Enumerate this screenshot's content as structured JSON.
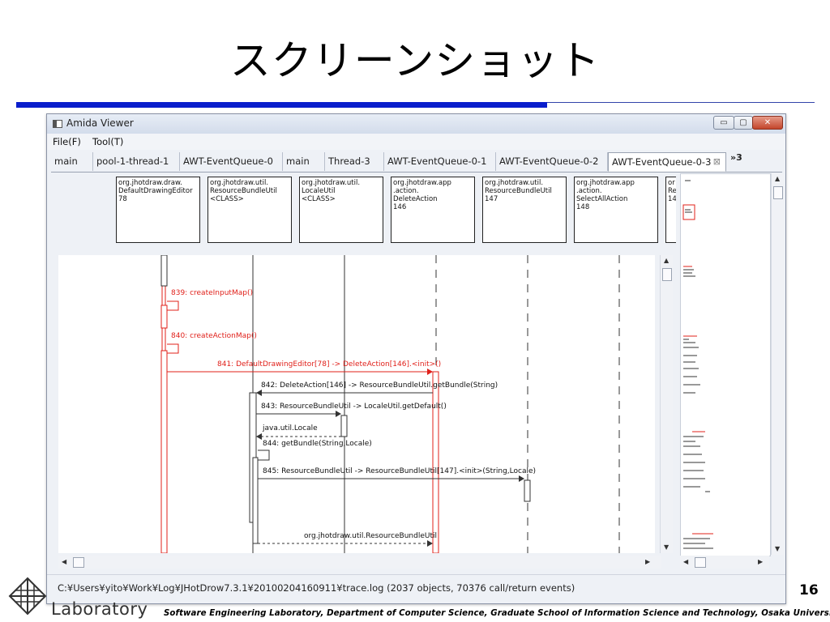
{
  "slide": {
    "title": "スクリーンショット",
    "page_number": "16",
    "logo_text": "Laboratory",
    "footer": "Software Engineering Laboratory, Department of Computer Science, Graduate School of Information Science and Technology, Osaka University"
  },
  "window": {
    "title": "Amida Viewer",
    "buttons": {
      "minimize": "▭",
      "maximize": "▢",
      "close": "✕"
    }
  },
  "menu": {
    "file": "File(F)",
    "tool": "Tool(T)"
  },
  "tabs": [
    {
      "label": "main"
    },
    {
      "label": "pool-1-thread-1"
    },
    {
      "label": "AWT-EventQueue-0"
    },
    {
      "label": "main"
    },
    {
      "label": "Thread-3"
    },
    {
      "label": "AWT-EventQueue-0-1"
    },
    {
      "label": "AWT-EventQueue-0-2"
    },
    {
      "label": "AWT-EventQueue-0-3",
      "active": true
    }
  ],
  "tab_more": "»3",
  "tab_close_glyph": "⊠",
  "lanes": [
    "org.jhotdraw.draw.\nDefaultDrawingEditor\n78",
    "org.jhotdraw.util.\nResourceBundleUtil\n<CLASS>",
    "org.jhotdraw.util.\nLocaleUtil\n<CLASS>",
    "org.jhotdraw.app\n.action.\nDeleteAction\n146",
    "org.jhotdraw.util.\nResourceBundleUtil\n147",
    "org.jhotdraw.app\n.action.\nSelectAllAction\n148",
    "or\nRe\n14"
  ],
  "messages": [
    "839: createInputMap()",
    "840: createActionMap()",
    "841: DefaultDrawingEditor[78] -> DeleteAction[146].<init>()",
    "842: DeleteAction[146] -> ResourceBundleUtil.getBundle(String)",
    "843: ResourceBundleUtil -> LocaleUtil.getDefault()",
    "java.util.Locale",
    "844: getBundle(String,Locale)",
    "845: ResourceBundleUtil -> ResourceBundleUtil[147].<init>(String,Locale)",
    "org.jhotdraw.util.ResourceBundleUtil"
  ],
  "status": "C:¥Users¥yito¥Work¥Log¥JHotDrow7.3.1¥20100204160911¥trace.log (2037 objects, 70376 call/return events)",
  "colors": {
    "call_highlight": "#e0201a",
    "accent_rule": "#0a1ecc",
    "lifeline": "#333333"
  }
}
